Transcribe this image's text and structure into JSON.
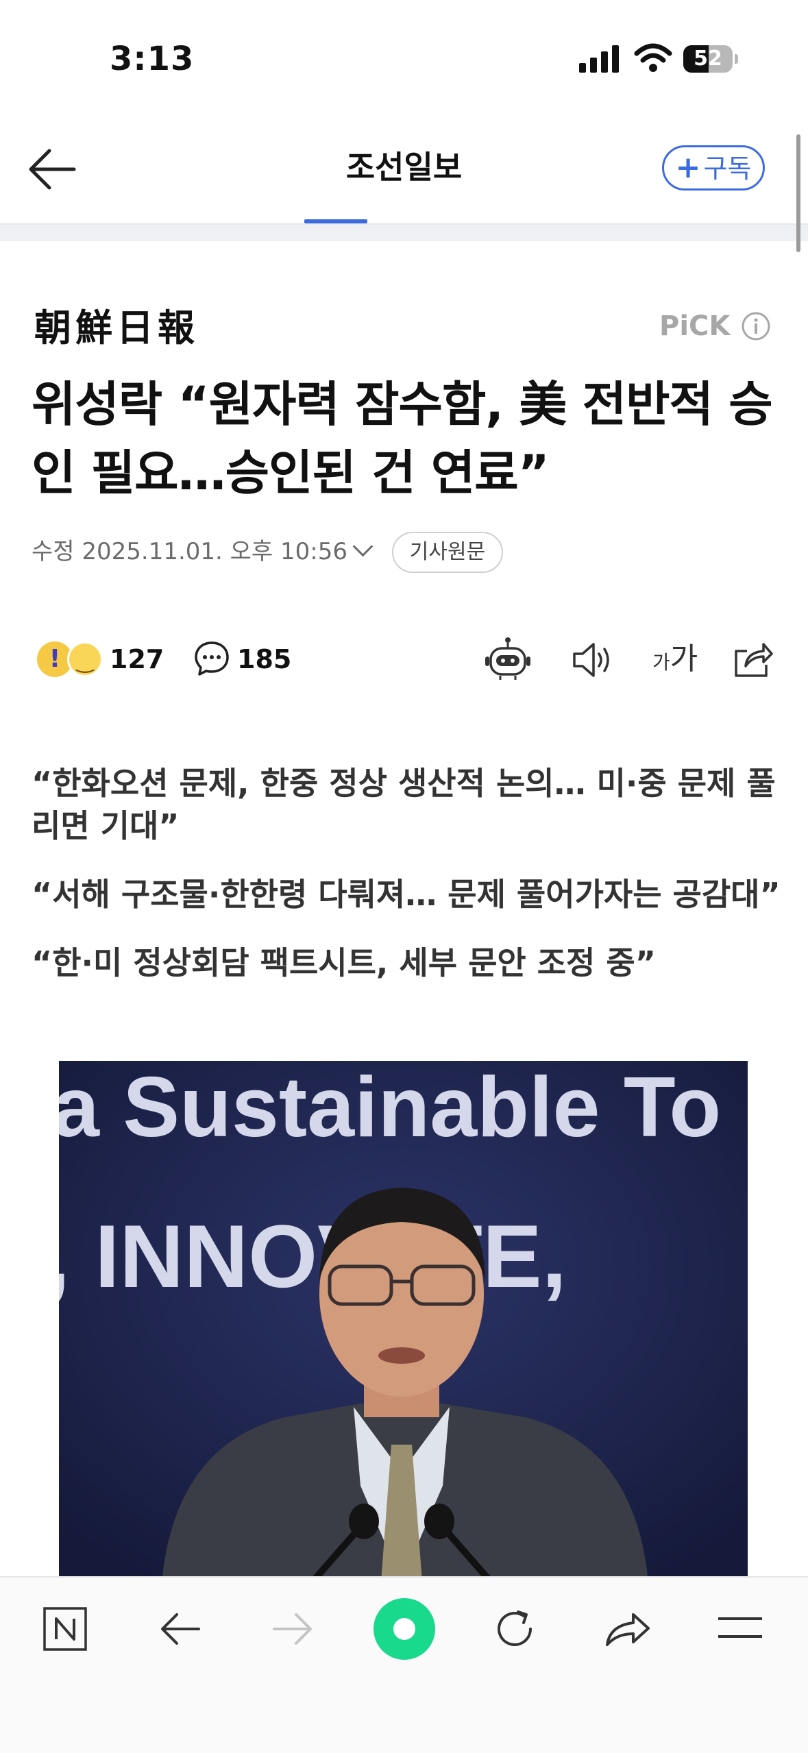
{
  "status_bar": {
    "time": "3:13",
    "battery": "52",
    "battery_level": 0.52
  },
  "header": {
    "title": "조선일보",
    "subscribe_label": "구독",
    "subscribe_plus": "+"
  },
  "article": {
    "logo_text": "朝鮮日報",
    "pick_label": "PiCK",
    "headline": "위성락 “원자력 잠수함, 美 전반적 승인 필요…승인된 건 연료”",
    "date": "수정 2025.11.01. 오후 10:56",
    "origin_button": "기사원문",
    "reaction_count": "127",
    "comment_count": "185",
    "font_label_small": "가",
    "font_label_big": "가",
    "summary": [
      "“한화오션 문제, 한중 정상 생산적 논의… 미·중 문제 풀리면 기대”",
      "“서해 구조물·한한령 다뤄져… 문제 풀어가자는 공감대”",
      "“한·미 정상회담 팩트시트, 세부 문안 조정 중”"
    ],
    "photo_text_line1": "a Sustainable To",
    "photo_text_line2": ", INNOVATE,"
  },
  "icons": {
    "back": "arrow-left-icon",
    "info": "info-icon",
    "comment": "comment-icon",
    "bot": "robot-icon",
    "speaker": "speaker-icon",
    "share": "share-icon",
    "n_home": "naver-n-icon",
    "menu": "menu-icon"
  },
  "colors": {
    "accent": "#3c6be0",
    "home_button": "#19d98c",
    "photo_bg": "#22284d"
  }
}
